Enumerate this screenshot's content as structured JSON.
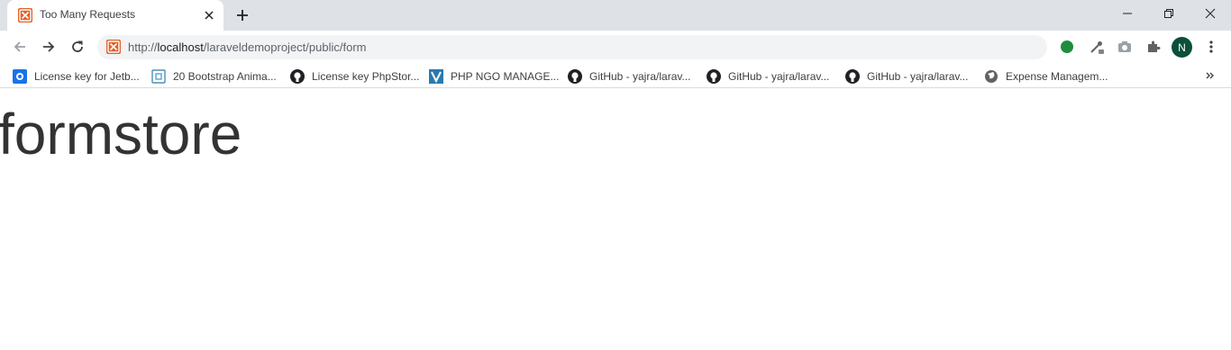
{
  "tab": {
    "title": "Too Many Requests",
    "favicon": "xampp-icon"
  },
  "address_bar": {
    "scheme": "http://",
    "host": "localhost",
    "path": "/laraveldemoproject/public/form"
  },
  "profile": {
    "initial": "N",
    "color": "#0b4f3c"
  },
  "bookmarks": [
    {
      "label": "License key for Jetb...",
      "icon": "jetbrains-icon"
    },
    {
      "label": "20 Bootstrap Anima...",
      "icon": "bootstrap-icon"
    },
    {
      "label": "License key PhpStor...",
      "icon": "github-icon"
    },
    {
      "label": "PHP NGO MANAGE...",
      "icon": "codecanyon-icon"
    },
    {
      "label": "GitHub - yajra/larav...",
      "icon": "github-icon"
    },
    {
      "label": "GitHub - yajra/larav...",
      "icon": "github-icon"
    },
    {
      "label": "GitHub - yajra/larav...",
      "icon": "github-icon"
    },
    {
      "label": "Expense Managem...",
      "icon": "globe-icon"
    }
  ],
  "page": {
    "heading": "formstore"
  },
  "colors": {
    "tabstrip": "#dee1e6",
    "omnibox": "#f1f3f4",
    "favicon": "#e0632b",
    "extension_green": "#1e8e3e"
  }
}
